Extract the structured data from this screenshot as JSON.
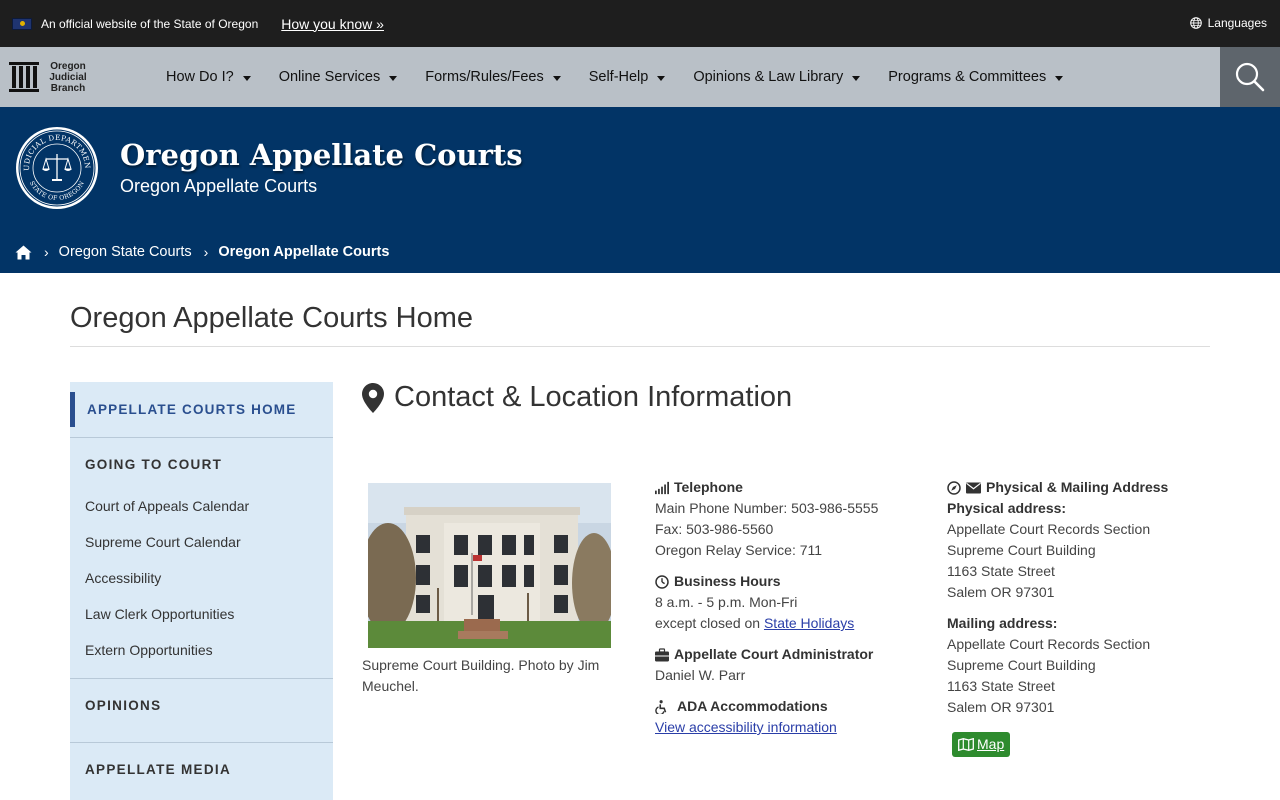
{
  "banner": {
    "official_text": "An official website of the State of Oregon",
    "how_you_know": "How you know »",
    "languages": "Languages"
  },
  "brand": {
    "line1": "Oregon",
    "line2": "Judicial",
    "line3": "Branch"
  },
  "nav": {
    "items": [
      {
        "label": "How Do I?"
      },
      {
        "label": "Online Services"
      },
      {
        "label": "Forms/Rules/Fees"
      },
      {
        "label": "Self-Help"
      },
      {
        "label": "Opinions & Law Library"
      },
      {
        "label": "Programs & Committees"
      }
    ]
  },
  "header": {
    "title": "Oregon Appellate Courts",
    "subtitle": "Oregon Appellate Courts",
    "seal_top": "JUDICIAL DEPARTMENT",
    "seal_bottom": "STATE OF OREGON"
  },
  "breadcrumb": {
    "items": [
      {
        "label": "Oregon State Courts"
      },
      {
        "label": "Oregon Appellate Courts"
      }
    ]
  },
  "page": {
    "title": "Oregon Appellate Courts Home"
  },
  "sidebar": {
    "active": "APPELLATE COURTS HOME",
    "sections": [
      {
        "label": "GOING TO COURT",
        "links": [
          {
            "label": "Court of Appeals Calendar"
          },
          {
            "label": "Supreme Court Calendar"
          },
          {
            "label": "Accessibility"
          },
          {
            "label": "Law Clerk Opportunities"
          },
          {
            "label": "Extern Opportunities"
          }
        ]
      },
      {
        "label": "OPINIONS"
      },
      {
        "label": "APPELLATE MEDIA"
      }
    ]
  },
  "contact": {
    "title": "Contact & Location Information",
    "photo_caption": "Supreme Court Building. Photo by Jim Meuchel.",
    "telephone": {
      "heading": "Telephone",
      "main": "Main Phone Number: 503-986-5555",
      "fax": "Fax: 503-986-5560",
      "relay": "Oregon Relay Service: 711"
    },
    "hours": {
      "heading": "Business Hours",
      "time": "8 a.m. - 5 p.m. Mon-Fri",
      "except": "except closed on",
      "holidays_link": "State Holidays"
    },
    "administrator": {
      "heading": "Appellate Court Administrator",
      "name": "Daniel W. Parr"
    },
    "ada": {
      "heading": "ADA Accommodations",
      "link": "View accessibility information"
    },
    "address": {
      "heading": "Physical & Mailing Address",
      "physical_label": "Physical address:",
      "physical": [
        "Appellate Court Records Section",
        "Supreme Court Building",
        "1163 State Street",
        "Salem OR 97301"
      ],
      "mailing_label": "Mailing address:",
      "mailing": [
        "Appellate Court Records Section",
        "Supreme Court Building",
        "1163 State Street",
        "Salem OR 97301"
      ],
      "map_button": "Map"
    }
  },
  "colors": {
    "banner_bg": "#1e1e1e",
    "nav_bg": "#b9c0c7",
    "header_bg": "#023466",
    "sidebar_bg": "#dbeaf6",
    "accent": "#2a4f8f",
    "map_button": "#2e8b2e"
  }
}
